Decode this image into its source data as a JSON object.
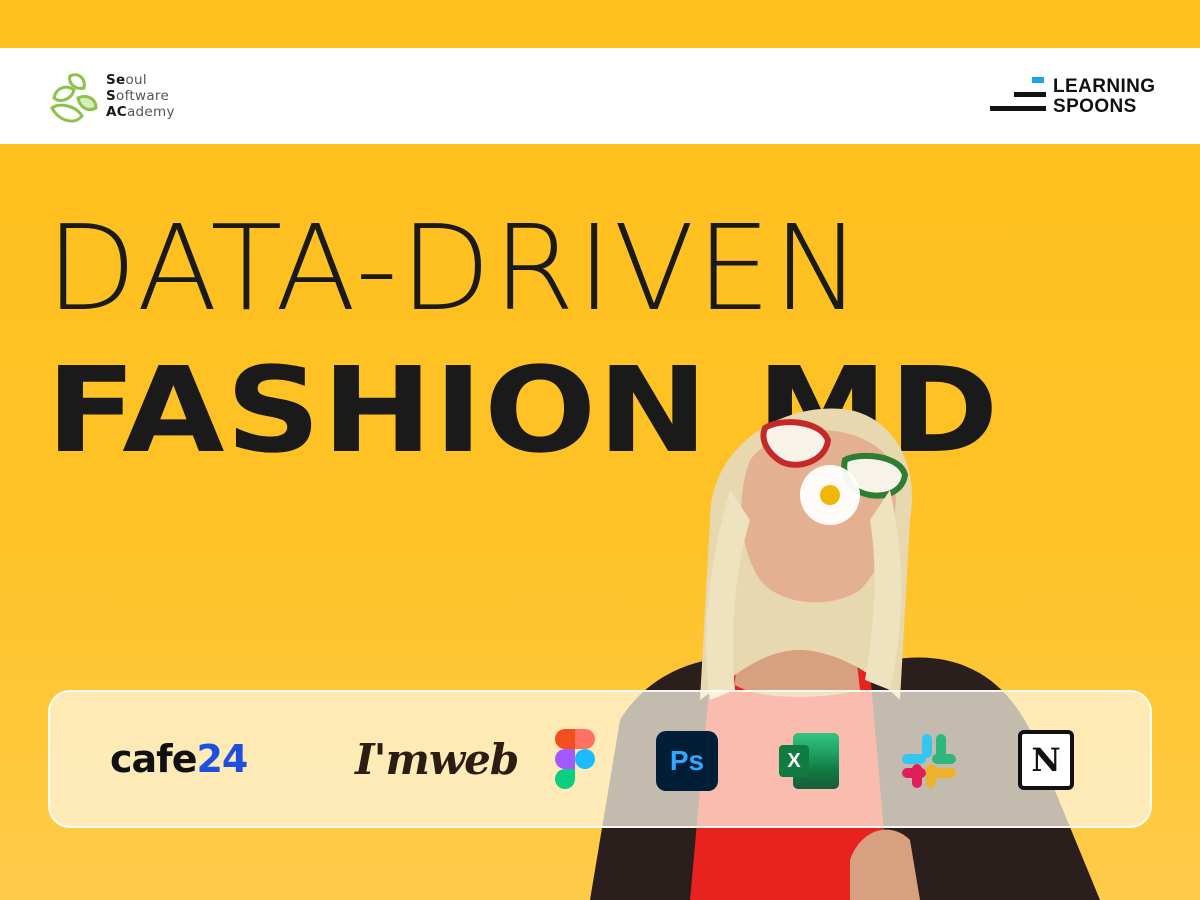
{
  "header": {
    "left_logo": {
      "name": "sesac-leaf-logo",
      "lines": [
        [
          "Se",
          "oul"
        ],
        [
          "S",
          "oftware"
        ],
        [
          "AC",
          "ademy"
        ]
      ]
    },
    "right_logo": {
      "name": "learning-spoons-logo",
      "line1": "LEARNING",
      "line2": "SPOONS",
      "accent": "#1DA1F2"
    }
  },
  "title": {
    "line1": "DATA-DRIVEN",
    "line2": "FASHION MD"
  },
  "tools": [
    {
      "name": "cafe24-logo",
      "text_a": "cafe",
      "text_b": "24"
    },
    {
      "name": "imweb-logo",
      "text": "I'mweb"
    },
    {
      "name": "figma-icon"
    },
    {
      "name": "photoshop-icon",
      "text": "Ps"
    },
    {
      "name": "excel-icon",
      "text": "X"
    },
    {
      "name": "slack-icon"
    },
    {
      "name": "notion-icon",
      "text": "N"
    }
  ],
  "colors": {
    "background": "#FFC01E",
    "text": "#1a1a1a",
    "cafe24_blue": "#1F4FE0"
  }
}
